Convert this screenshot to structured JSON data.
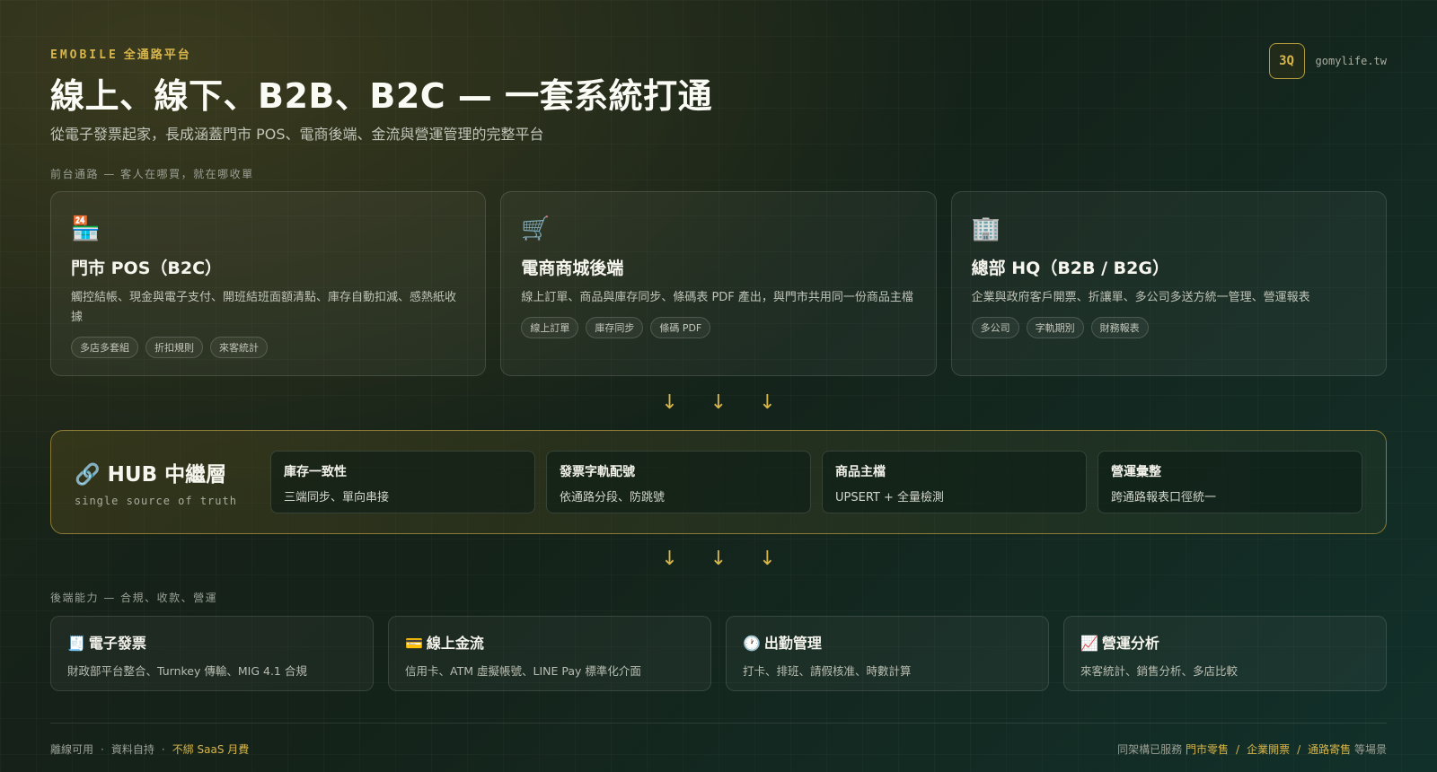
{
  "header": {
    "eyebrow_en": "EMOBILE",
    "eyebrow_cn": "全通路平台",
    "title": "線上、線下、B2B、B2C — 一套系統打通",
    "subtitle": "從電子發票起家，長成涵蓋門市 POS、電商後端、金流與營運管理的完整平台"
  },
  "brand": {
    "badge": "3Q",
    "site": "gomylife.tw"
  },
  "front_section": {
    "label": "前台通路 — 客人在哪買，就在哪收單"
  },
  "front_cards": [
    {
      "icon": "🏪",
      "title": "門市 POS（B2C）",
      "desc": "觸控結帳、現金與電子支付、開班結班面額清點、庫存自動扣減、感熱紙收據",
      "tags": [
        "多店多套組",
        "折扣規則",
        "來客統計"
      ]
    },
    {
      "icon": "🛒",
      "title": "電商商城後端",
      "desc": "線上訂單、商品與庫存同步、條碼表 PDF 產出，與門市共用同一份商品主檔",
      "tags": [
        "線上訂單",
        "庫存同步",
        "條碼 PDF"
      ]
    },
    {
      "icon": "🏢",
      "title": "總部 HQ（B2B / B2G）",
      "desc": "企業與政府客戶開票、折讓單、多公司多送方統一管理、營運報表",
      "tags": [
        "多公司",
        "字軌期別",
        "財務報表"
      ]
    }
  ],
  "arrows": [
    "↓",
    "↓",
    "↓"
  ],
  "hub": {
    "title": "🔗 HUB 中繼層",
    "subtitle": "single source of truth",
    "items": [
      {
        "title": "庫存一致性",
        "desc": "三端同步、單向串接"
      },
      {
        "title": "發票字軌配號",
        "desc": "依通路分段、防跳號"
      },
      {
        "title": "商品主檔",
        "desc": "UPSERT + 全量檢測"
      },
      {
        "title": "營運彙整",
        "desc": "跨通路報表口徑統一"
      }
    ]
  },
  "back_section": {
    "label": "後端能力 — 合規、收款、營運"
  },
  "back_cards": [
    {
      "icon": "🧾",
      "title": "電子發票",
      "desc": "財政部平台整合、Turnkey 傳輸、MIG 4.1 合規"
    },
    {
      "icon": "💳",
      "title": "線上金流",
      "desc": "信用卡、ATM 虛擬帳號、LINE Pay 標準化介面"
    },
    {
      "icon": "🕐",
      "title": "出勤管理",
      "desc": "打卡、排班、請假核准、時數計算"
    },
    {
      "icon": "📈",
      "title": "營運分析",
      "desc": "來客統計、銷售分析、多店比較"
    }
  ],
  "footer": {
    "left": [
      "離線可用",
      "資料自持",
      "不綁 SaaS 月費"
    ],
    "left_sep": "·",
    "right_prefix": "同架構已服務",
    "right_items": [
      "門市零售",
      "企業開票",
      "通路寄售"
    ],
    "right_sep": "/",
    "right_suffix": "等場景"
  },
  "colors": {
    "accent": "#d7b54a",
    "background": "#142219",
    "hub_border": "#8a7a34"
  }
}
